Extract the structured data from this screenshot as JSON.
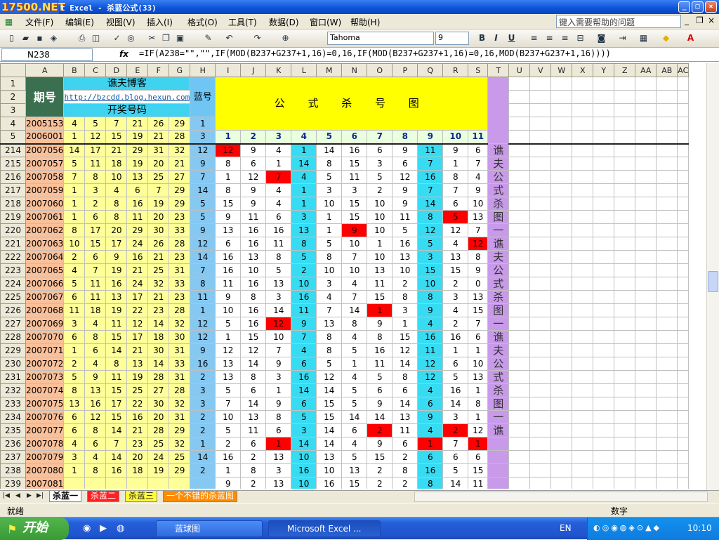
{
  "window": {
    "logo": "17500.NET",
    "title": "t Excel - 杀蓝公式(33)",
    "min": "_",
    "max": "□",
    "close": "×"
  },
  "menubar": {
    "items": [
      "文件(F)",
      "编辑(E)",
      "视图(V)",
      "插入(I)",
      "格式(O)",
      "工具(T)",
      "数据(D)",
      "窗口(W)",
      "帮助(H)"
    ],
    "help_placeholder": "键入需要帮助的问题",
    "doc_min": "_",
    "doc_restore": "❐",
    "doc_close": "×"
  },
  "toolbar": {
    "font": "Tahoma",
    "size": "9",
    "bold": "B",
    "italic": "I",
    "underline": "U"
  },
  "formula_bar": {
    "cell": "N238",
    "fx": "fx",
    "formula": "=IF(A238=\"\",\"\",IF(MOD(B237+G237+1,16)=0,16,IF(MOD(B237+G237+1,16)=0,16,MOD(B237+G237+1,16))))"
  },
  "columns": [
    "A",
    "B",
    "C",
    "D",
    "E",
    "F",
    "G",
    "H",
    "I",
    "J",
    "K",
    "L",
    "M",
    "N",
    "O",
    "P",
    "Q",
    "R",
    "S",
    "T",
    "U",
    "V",
    "W",
    "X",
    "Y",
    "Z",
    "AA",
    "AB",
    "AC"
  ],
  "header": {
    "qihao": "期号",
    "author": "谯夫博客",
    "link": "http://bzcdd.blog.hexun.com",
    "kaijiang": "开奖号码",
    "lanhao": "蓝号",
    "formula_title": "公 式 杀 号 图",
    "formula_nums": [
      "1",
      "2",
      "3",
      "4",
      "5",
      "6",
      "7",
      "8",
      "9",
      "10",
      "11"
    ],
    "formula_tiny": [
      "■■■■■■",
      "■■■■",
      "■■■■",
      "■■■",
      "■■■■",
      "■■■■",
      "■■■■■■",
      "■■■■■■",
      "■■■■■",
      "■■■■",
      "■■"
    ]
  },
  "top_rows": [
    {
      "row": "4",
      "issue": "2005153",
      "nums": [
        "4",
        "5",
        "7",
        "21",
        "26",
        "29"
      ],
      "blue": "1"
    },
    {
      "row": "5",
      "issue": "2006001",
      "nums": [
        "1",
        "12",
        "15",
        "19",
        "21",
        "28"
      ],
      "blue": "3"
    }
  ],
  "rows": [
    {
      "row": "214",
      "issue": "2007056",
      "nums": [
        "14",
        "17",
        "21",
        "29",
        "31",
        "32"
      ],
      "blue": "12",
      "k": [
        "12",
        "9",
        "4",
        "1",
        "14",
        "16",
        "6",
        "9",
        "11",
        "9",
        "6"
      ]
    },
    {
      "row": "215",
      "issue": "2007057",
      "nums": [
        "5",
        "11",
        "18",
        "19",
        "20",
        "21"
      ],
      "blue": "9",
      "k": [
        "8",
        "6",
        "1",
        "14",
        "8",
        "15",
        "3",
        "6",
        "7",
        "1",
        "7"
      ]
    },
    {
      "row": "216",
      "issue": "2007058",
      "nums": [
        "7",
        "8",
        "10",
        "13",
        "25",
        "27"
      ],
      "blue": "7",
      "k": [
        "1",
        "12",
        "7",
        "4",
        "5",
        "11",
        "5",
        "12",
        "16",
        "8",
        "4"
      ]
    },
    {
      "row": "217",
      "issue": "2007059",
      "nums": [
        "1",
        "3",
        "4",
        "6",
        "7",
        "29"
      ],
      "blue": "14",
      "k": [
        "8",
        "9",
        "4",
        "1",
        "3",
        "3",
        "2",
        "9",
        "7",
        "7",
        "9"
      ]
    },
    {
      "row": "218",
      "issue": "2007060",
      "nums": [
        "1",
        "2",
        "8",
        "16",
        "19",
        "29"
      ],
      "blue": "5",
      "k": [
        "15",
        "9",
        "4",
        "1",
        "10",
        "15",
        "10",
        "9",
        "14",
        "6",
        "10"
      ]
    },
    {
      "row": "219",
      "issue": "2007061",
      "nums": [
        "1",
        "6",
        "8",
        "11",
        "20",
        "23"
      ],
      "blue": "5",
      "k": [
        "9",
        "11",
        "6",
        "3",
        "1",
        "15",
        "10",
        "11",
        "8",
        "5",
        "13"
      ]
    },
    {
      "row": "220",
      "issue": "2007062",
      "nums": [
        "8",
        "17",
        "20",
        "29",
        "30",
        "33"
      ],
      "blue": "9",
      "k": [
        "13",
        "16",
        "16",
        "13",
        "1",
        "9",
        "10",
        "5",
        "12",
        "12",
        "7"
      ]
    },
    {
      "row": "221",
      "issue": "2007063",
      "nums": [
        "10",
        "15",
        "17",
        "24",
        "26",
        "28"
      ],
      "blue": "12",
      "k": [
        "6",
        "16",
        "11",
        "8",
        "5",
        "10",
        "1",
        "16",
        "5",
        "4",
        "12"
      ]
    },
    {
      "row": "222",
      "issue": "2007064",
      "nums": [
        "2",
        "6",
        "9",
        "16",
        "21",
        "23"
      ],
      "blue": "14",
      "k": [
        "16",
        "13",
        "8",
        "5",
        "8",
        "7",
        "10",
        "13",
        "3",
        "13",
        "8"
      ]
    },
    {
      "row": "223",
      "issue": "2007065",
      "nums": [
        "4",
        "7",
        "19",
        "21",
        "25",
        "31"
      ],
      "blue": "7",
      "k": [
        "16",
        "10",
        "5",
        "2",
        "10",
        "10",
        "13",
        "10",
        "15",
        "15",
        "9"
      ]
    },
    {
      "row": "224",
      "issue": "2007066",
      "nums": [
        "5",
        "11",
        "16",
        "24",
        "32",
        "33"
      ],
      "blue": "8",
      "k": [
        "11",
        "16",
        "13",
        "10",
        "3",
        "4",
        "11",
        "2",
        "10",
        "2",
        "0"
      ]
    },
    {
      "row": "225",
      "issue": "2007067",
      "nums": [
        "6",
        "11",
        "13",
        "17",
        "21",
        "23"
      ],
      "blue": "11",
      "k": [
        "9",
        "8",
        "3",
        "16",
        "4",
        "7",
        "15",
        "8",
        "8",
        "3",
        "13"
      ]
    },
    {
      "row": "226",
      "issue": "2007068",
      "nums": [
        "11",
        "18",
        "19",
        "22",
        "23",
        "28"
      ],
      "blue": "1",
      "k": [
        "10",
        "16",
        "14",
        "11",
        "7",
        "14",
        "1",
        "3",
        "9",
        "4",
        "15"
      ]
    },
    {
      "row": "227",
      "issue": "2007069",
      "nums": [
        "3",
        "4",
        "11",
        "12",
        "14",
        "32"
      ],
      "blue": "12",
      "k": [
        "5",
        "16",
        "12",
        "9",
        "13",
        "8",
        "9",
        "1",
        "4",
        "2",
        "7"
      ]
    },
    {
      "row": "228",
      "issue": "2007070",
      "nums": [
        "6",
        "8",
        "15",
        "17",
        "18",
        "30"
      ],
      "blue": "12",
      "k": [
        "1",
        "15",
        "10",
        "7",
        "8",
        "4",
        "8",
        "15",
        "16",
        "16",
        "6"
      ]
    },
    {
      "row": "229",
      "issue": "2007071",
      "nums": [
        "1",
        "6",
        "14",
        "21",
        "30",
        "31"
      ],
      "blue": "9",
      "k": [
        "12",
        "12",
        "7",
        "4",
        "8",
        "5",
        "16",
        "12",
        "11",
        "1",
        "1"
      ]
    },
    {
      "row": "230",
      "issue": "2007072",
      "nums": [
        "2",
        "4",
        "8",
        "13",
        "14",
        "33"
      ],
      "blue": "16",
      "k": [
        "13",
        "14",
        "9",
        "6",
        "5",
        "1",
        "11",
        "14",
        "12",
        "6",
        "10"
      ]
    },
    {
      "row": "231",
      "issue": "2007073",
      "nums": [
        "5",
        "9",
        "11",
        "19",
        "28",
        "31"
      ],
      "blue": "2",
      "k": [
        "13",
        "8",
        "3",
        "16",
        "12",
        "4",
        "5",
        "8",
        "12",
        "5",
        "13"
      ]
    },
    {
      "row": "232",
      "issue": "2007074",
      "nums": [
        "8",
        "13",
        "15",
        "25",
        "27",
        "28"
      ],
      "blue": "3",
      "k": [
        "5",
        "6",
        "1",
        "14",
        "14",
        "5",
        "6",
        "6",
        "4",
        "16",
        "1"
      ]
    },
    {
      "row": "233",
      "issue": "2007075",
      "nums": [
        "13",
        "16",
        "17",
        "22",
        "30",
        "32"
      ],
      "blue": "3",
      "k": [
        "7",
        "14",
        "9",
        "6",
        "15",
        "5",
        "9",
        "14",
        "6",
        "14",
        "8"
      ]
    },
    {
      "row": "234",
      "issue": "2007076",
      "nums": [
        "6",
        "12",
        "15",
        "16",
        "20",
        "31"
      ],
      "blue": "2",
      "k": [
        "10",
        "13",
        "8",
        "5",
        "15",
        "14",
        "14",
        "13",
        "9",
        "3",
        "1"
      ]
    },
    {
      "row": "235",
      "issue": "2007077",
      "nums": [
        "6",
        "8",
        "14",
        "21",
        "28",
        "29"
      ],
      "blue": "2",
      "k": [
        "5",
        "11",
        "6",
        "3",
        "14",
        "6",
        "2",
        "11",
        "4",
        "2",
        "12"
      ]
    },
    {
      "row": "236",
      "issue": "2007078",
      "nums": [
        "4",
        "6",
        "7",
        "23",
        "25",
        "32"
      ],
      "blue": "1",
      "k": [
        "2",
        "6",
        "1",
        "14",
        "14",
        "4",
        "9",
        "6",
        "1",
        "7",
        "1"
      ]
    },
    {
      "row": "237",
      "issue": "2007079",
      "nums": [
        "3",
        "4",
        "14",
        "20",
        "24",
        "25"
      ],
      "blue": "14",
      "k": [
        "16",
        "2",
        "13",
        "10",
        "13",
        "5",
        "15",
        "2",
        "6",
        "6",
        "6"
      ]
    },
    {
      "row": "238",
      "issue": "2007080",
      "nums": [
        "1",
        "8",
        "16",
        "18",
        "19",
        "29"
      ],
      "blue": "2",
      "k": [
        "1",
        "8",
        "3",
        "16",
        "10",
        "13",
        "2",
        "8",
        "16",
        "5",
        "15"
      ]
    },
    {
      "row": "239",
      "issue": "2007081",
      "nums": [
        "",
        "",
        "",
        "",
        "",
        "",
        ""
      ],
      "blue": "",
      "k": [
        "9",
        "2",
        "13",
        "10",
        "16",
        "15",
        "2",
        "2",
        "8",
        "14",
        "11"
      ]
    }
  ],
  "red_cells": [
    [
      0,
      0
    ],
    [
      2,
      2
    ],
    [
      5,
      9
    ],
    [
      6,
      5
    ],
    [
      7,
      10
    ],
    [
      12,
      6
    ],
    [
      13,
      2
    ],
    [
      21,
      6
    ],
    [
      21,
      9
    ],
    [
      22,
      2
    ],
    [
      22,
      8
    ],
    [
      22,
      10
    ]
  ],
  "side_text": [
    "谯",
    "夫",
    "公",
    "式",
    "杀",
    "图",
    "一",
    "谯",
    "夫",
    "公",
    "式",
    "杀",
    "图",
    "一",
    "谯",
    "夫",
    "公",
    "式",
    "杀",
    "图",
    "一",
    "谯"
  ],
  "sheet_tabs": [
    "杀蓝一",
    "杀蓝二",
    "杀蓝三",
    "一个不错的杀蓝图"
  ],
  "status": {
    "left": "就绪",
    "right": "数字"
  },
  "taskbar": {
    "start": "开始",
    "tasks": [
      "蓝球图",
      "Microsoft Excel ..."
    ],
    "lang": "EN",
    "time": "10:10"
  },
  "colors": {
    "title_blue": "#0a52d6",
    "header_green": "#3a7050",
    "issue_pink": "#f9c09a",
    "num_yellow": "#ffff99",
    "blue_col": "#85c8f2",
    "l_col_cyan": "#38dcf2",
    "kill_red": "#ff0000",
    "purple_col": "#c89ae9",
    "formula_yellow": "#ffff00"
  }
}
